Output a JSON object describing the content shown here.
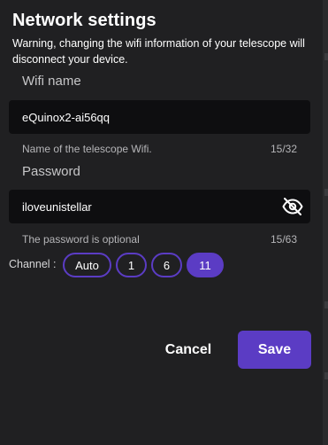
{
  "dialog": {
    "title": "Network settings",
    "warning": "Warning, changing the wifi information of your telescope will disconnect your device."
  },
  "wifi_name": {
    "label": "Wifi name",
    "value": "eQuinox2-ai56qq",
    "helper": "Name of the telescope Wifi.",
    "counter": "15/32"
  },
  "password": {
    "label": "Password",
    "value": "iloveunistellar",
    "helper": "The password is optional",
    "counter": "15/63",
    "visibility_icon": "eye-off-icon"
  },
  "channel": {
    "label": "Channel :",
    "options": [
      "Auto",
      "1",
      "6",
      "11"
    ],
    "selected": "11"
  },
  "actions": {
    "cancel_label": "Cancel",
    "save_label": "Save"
  },
  "colors": {
    "accent": "#5b3cc4",
    "background": "#202022",
    "input_background": "#0e0e10"
  }
}
